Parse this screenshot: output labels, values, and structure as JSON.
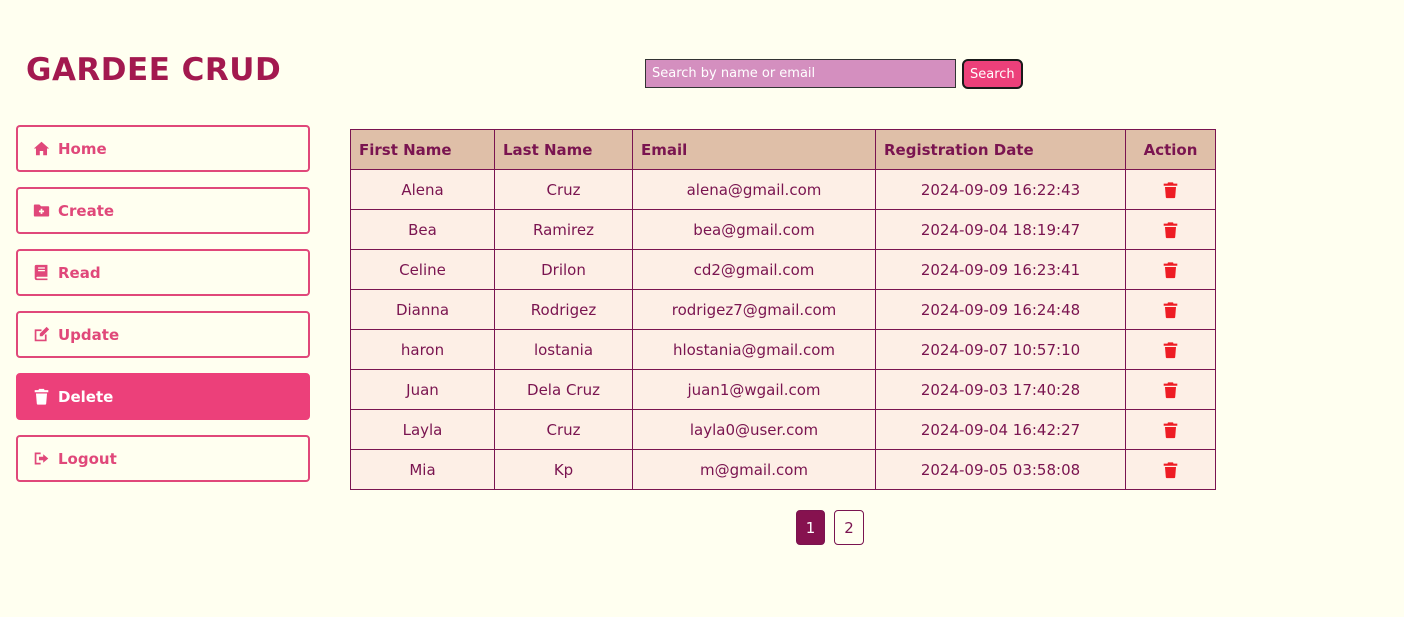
{
  "app": {
    "title": "GARDEE CRUD"
  },
  "search": {
    "placeholder": "Search by name or email",
    "value": "",
    "button_label": "Search"
  },
  "sidebar": {
    "items": [
      {
        "label": "Home",
        "icon": "home-icon",
        "active": false
      },
      {
        "label": "Create",
        "icon": "folder-plus-icon",
        "active": false
      },
      {
        "label": "Read",
        "icon": "book-icon",
        "active": false
      },
      {
        "label": "Update",
        "icon": "edit-icon",
        "active": false
      },
      {
        "label": "Delete",
        "icon": "trash-icon",
        "active": true
      },
      {
        "label": "Logout",
        "icon": "logout-icon",
        "active": false
      }
    ]
  },
  "table": {
    "headers": [
      "First Name",
      "Last Name",
      "Email",
      "Registration Date",
      "Action"
    ],
    "rows": [
      [
        "Alena",
        "Cruz",
        "alena@gmail.com",
        "2024-09-09 16:22:43"
      ],
      [
        "Bea",
        "Ramirez",
        "bea@gmail.com",
        "2024-09-04 18:19:47"
      ],
      [
        "Celine",
        "Drilon",
        "cd2@gmail.com",
        "2024-09-09 16:23:41"
      ],
      [
        "Dianna",
        "Rodrigez",
        "rodrigez7@gmail.com",
        "2024-09-09 16:24:48"
      ],
      [
        "haron",
        "lostania",
        "hlostania@gmail.com",
        "2024-09-07 10:57:10"
      ],
      [
        "Juan",
        "Dela Cruz",
        "juan1@wgail.com",
        "2024-09-03 17:40:28"
      ],
      [
        "Layla",
        "Cruz",
        "layla0@user.com",
        "2024-09-04 16:42:27"
      ],
      [
        "Mia",
        "Kp",
        "m@gmail.com",
        "2024-09-05 03:58:08"
      ]
    ],
    "action_icon": "trash-icon"
  },
  "pagination": {
    "pages": [
      "1",
      "2"
    ],
    "current": "1"
  },
  "colors": {
    "accent": "#ec407a",
    "delete": "#ee1c24",
    "header_bg": "#dfbfa8",
    "row_bg": "#fdefe6"
  }
}
